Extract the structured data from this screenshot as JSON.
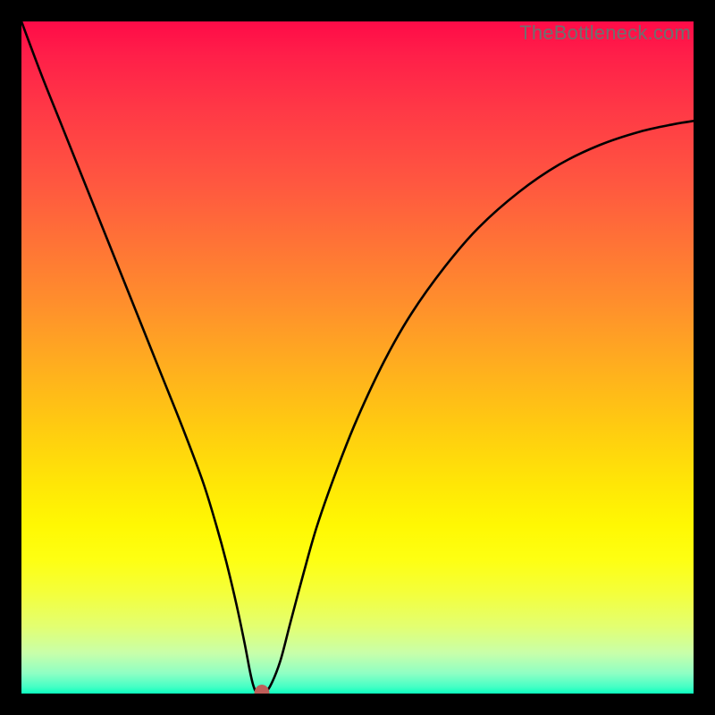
{
  "branding": "TheBottleneck.com",
  "chart_data": {
    "type": "line",
    "title": "",
    "xlabel": "",
    "ylabel": "",
    "xlim": [
      0,
      100
    ],
    "ylim": [
      0,
      100
    ],
    "grid": false,
    "series": [
      {
        "name": "bottleneck-curve",
        "x": [
          0,
          3,
          6,
          9,
          12,
          15,
          18,
          21,
          24,
          27,
          29,
          30.5,
          32,
          33.2,
          34,
          34.5,
          35,
          36,
          37,
          38.5,
          40,
          42,
          44,
          47,
          50,
          54,
          58,
          63,
          68,
          74,
          80,
          86,
          92,
          97,
          100
        ],
        "y": [
          100,
          92,
          84.5,
          77,
          69.5,
          62,
          54.5,
          47,
          39.5,
          31.5,
          25,
          19.5,
          13.2,
          7.5,
          3.3,
          1.2,
          0.2,
          0.1,
          1.1,
          4.8,
          10.5,
          18,
          25,
          33.5,
          41,
          49.5,
          56.5,
          63.5,
          69.3,
          74.6,
          78.7,
          81.6,
          83.6,
          84.7,
          85.2
        ]
      }
    ],
    "annotations": [
      {
        "type": "point",
        "name": "curve-minimum",
        "x": 35.8,
        "y": 0,
        "color": "#bf5e59"
      }
    ]
  },
  "colors": {
    "curve_stroke": "#000000",
    "dot_fill": "#bf5e59",
    "frame": "#000000"
  }
}
